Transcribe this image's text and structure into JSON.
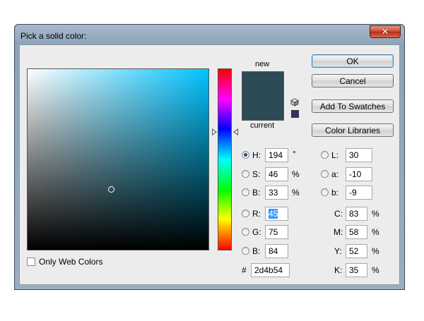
{
  "dialog": {
    "title": "Pick a solid color:",
    "close_glyph": "✕"
  },
  "colors": {
    "new": "#2d4b54",
    "current": "#2d4b54",
    "websafe": "#333366"
  },
  "preview": {
    "new_label": "new",
    "current_label": "current"
  },
  "buttons": {
    "ok": "OK",
    "cancel": "Cancel",
    "add_to_swatches": "Add To Swatches",
    "color_libraries": "Color Libraries"
  },
  "hsb": {
    "h_label": "H:",
    "h_value": "194",
    "h_unit": "°",
    "s_label": "S:",
    "s_value": "46",
    "s_unit": "%",
    "b_label": "B:",
    "b_value": "33",
    "b_unit": "%"
  },
  "lab": {
    "l_label": "L:",
    "l_value": "30",
    "a_label": "a:",
    "a_value": "-10",
    "b_label": "b:",
    "b_value": "-9"
  },
  "rgb": {
    "r_label": "R:",
    "r_value": "45",
    "g_label": "G:",
    "g_value": "75",
    "b_label": "B:",
    "b_value": "84"
  },
  "cmyk": {
    "c_label": "C:",
    "c_value": "83",
    "c_unit": "%",
    "m_label": "M:",
    "m_value": "58",
    "m_unit": "%",
    "y_label": "Y:",
    "y_value": "52",
    "y_unit": "%",
    "k_label": "K:",
    "k_value": "35",
    "k_unit": "%"
  },
  "hex": {
    "label": "#",
    "value": "2d4b54"
  },
  "options": {
    "only_web_colors": "Only Web Colors"
  }
}
